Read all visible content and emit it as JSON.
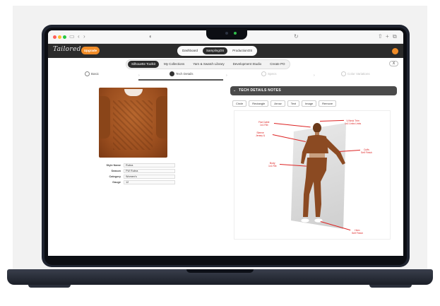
{
  "browser": {
    "lock_icon": "shield-icon"
  },
  "app": {
    "logo": "Tailored",
    "upgrade_label": "Upgrade",
    "brand_color": "#f08c28",
    "top_tabs": [
      "Dashboard",
      "SamplingOS",
      "ProductionOS"
    ],
    "sub_tabs": [
      "Silhouette Toolkit",
      "My Collections",
      "Yarn & Swatch Library",
      "Development Studio",
      "Create PO"
    ],
    "close_label": "X"
  },
  "stepper": {
    "steps": [
      "Basic",
      "Tech Details",
      "Specs",
      "Color Variations"
    ]
  },
  "specs": [
    {
      "key": "Style Name",
      "value": "Rubra"
    },
    {
      "key": "Season",
      "value": "FW Rubra"
    },
    {
      "key": "Category",
      "value": "Women's"
    },
    {
      "key": "Gauge",
      "value": "12"
    }
  ],
  "tech": {
    "title": "TECH DETAILS NOTES",
    "tools": [
      "Circle",
      "Rectangle",
      "Arrow",
      "Text",
      "Image",
      "Remove"
    ],
    "annotations": [
      "Flat Cable\n1x1 Rib",
      "V-Neck Trim\n1x1 Links Links",
      "Sleeve\nJersey &",
      "Body\n1x1 Rib",
      "Cuffs\nSelf Finish",
      "Hem\nSelf Finish"
    ],
    "annotation_color": "#dd2222"
  }
}
